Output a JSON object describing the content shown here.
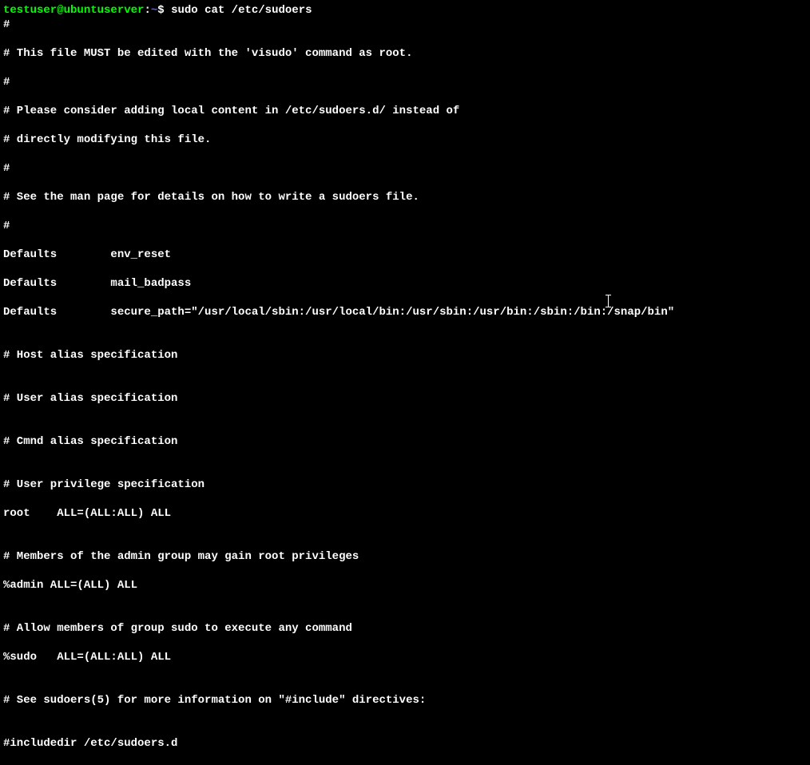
{
  "prompt": {
    "user_host": "testuser@ubuntuserver",
    "colon": ":",
    "path": "~",
    "dollar": "$ "
  },
  "command": "sudo cat /etc/sudoers",
  "output_lines": [
    "#",
    "# This file MUST be edited with the 'visudo' command as root.",
    "#",
    "# Please consider adding local content in /etc/sudoers.d/ instead of",
    "# directly modifying this file.",
    "#",
    "# See the man page for details on how to write a sudoers file.",
    "#",
    "Defaults        env_reset",
    "Defaults        mail_badpass",
    "Defaults        secure_path=\"/usr/local/sbin:/usr/local/bin:/usr/sbin:/usr/bin:/sbin:/bin:/snap/bin\"",
    "",
    "# Host alias specification",
    "",
    "# User alias specification",
    "",
    "# Cmnd alias specification",
    "",
    "# User privilege specification",
    "root    ALL=(ALL:ALL) ALL",
    "",
    "# Members of the admin group may gain root privileges",
    "%admin ALL=(ALL) ALL",
    "",
    "# Allow members of group sudo to execute any command",
    "%sudo   ALL=(ALL:ALL) ALL",
    "",
    "# See sudoers(5) for more information on \"#include\" directives:",
    "",
    "#includedir /etc/sudoers.d"
  ]
}
